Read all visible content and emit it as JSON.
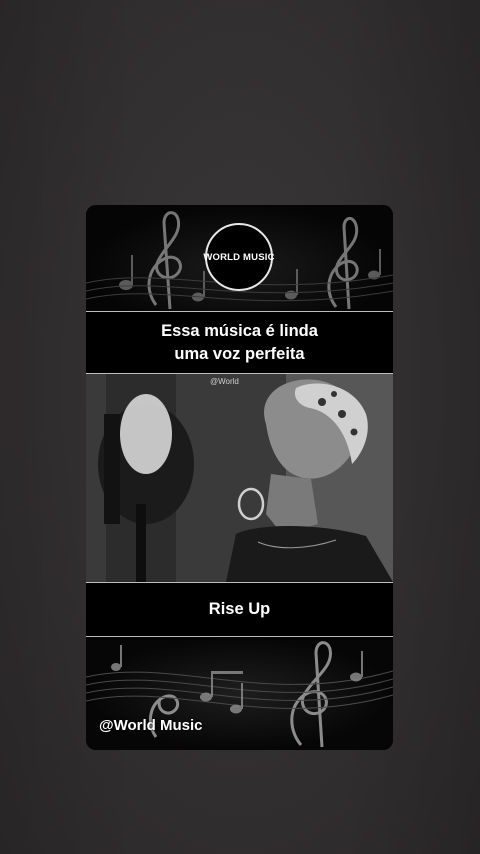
{
  "story": {
    "logo_text": "WORLD MUSIC",
    "caption_line1": "Essa música é linda",
    "caption_line2": "uma voz perfeita",
    "photo_watermark": "@World",
    "song_title": "Rise Up",
    "handle": "@World Music"
  },
  "icons": {
    "top_decoration": "treble-clef-icon",
    "bottom_decoration": "music-notes-icon"
  },
  "colors": {
    "background": "#322f30",
    "card": "#030303",
    "text": "#ffffff",
    "divider": "#bdbdbd"
  }
}
